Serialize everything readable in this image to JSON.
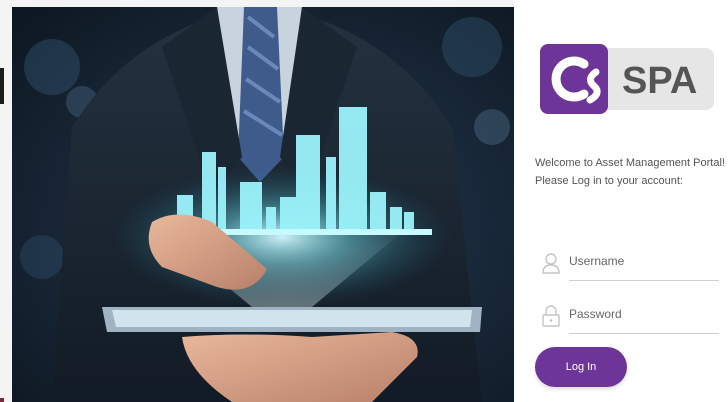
{
  "brand": {
    "logo_text": "SPA",
    "colors": {
      "purple": "#6c3597",
      "light_purple": "#8a4bb5",
      "logo_bg": "#e6e6e6",
      "text_gray": "#555555"
    }
  },
  "hero": {
    "icon": "businessman-holding-tablet-with-city-hologram"
  },
  "login": {
    "welcome_line1": "Welcome to Asset Management Portal!",
    "welcome_line2": "Please Log in to your account:",
    "username_placeholder": "Username",
    "password_placeholder": "Password",
    "login_label": "Log In",
    "username_icon": "user-icon",
    "password_icon": "lock-icon"
  }
}
